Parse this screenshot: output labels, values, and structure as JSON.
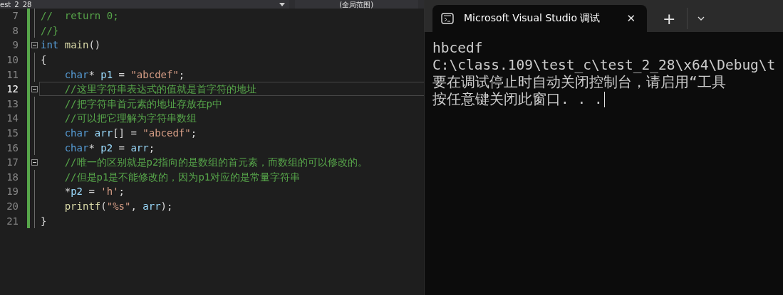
{
  "editor": {
    "file_selector": {
      "label": "est_2_28"
    },
    "scope_selector": {
      "label": "(全局范围)"
    },
    "lines": [
      {
        "number": "7",
        "current": false,
        "collapsible": false,
        "indented": false,
        "tokens": [
          {
            "kind": "comment",
            "text": "//  return 0;"
          }
        ]
      },
      {
        "number": "8",
        "current": false,
        "collapsible": false,
        "indented": false,
        "tokens": [
          {
            "kind": "comment",
            "text": "//}"
          }
        ]
      },
      {
        "number": "9",
        "current": false,
        "collapsible": true,
        "indented": false,
        "tokens": [
          {
            "kind": "keyword",
            "text": "int "
          },
          {
            "kind": "function",
            "text": "main"
          },
          {
            "kind": "plain",
            "text": "()"
          }
        ]
      },
      {
        "number": "10",
        "current": false,
        "collapsible": false,
        "indented": false,
        "tokens": [
          {
            "kind": "plain",
            "text": "{"
          }
        ]
      },
      {
        "number": "11",
        "current": false,
        "collapsible": false,
        "indented": true,
        "tokens": [
          {
            "kind": "keyword",
            "text": "char"
          },
          {
            "kind": "plain",
            "text": "* "
          },
          {
            "kind": "variable",
            "text": "p1"
          },
          {
            "kind": "plain",
            "text": " = "
          },
          {
            "kind": "string",
            "text": "\"abcdef\""
          },
          {
            "kind": "plain",
            "text": ";"
          }
        ]
      },
      {
        "number": "12",
        "current": true,
        "collapsible": true,
        "indented": true,
        "tokens": [
          {
            "kind": "comment",
            "text": "//这里字符串表达式的值就是首字符的地址"
          }
        ]
      },
      {
        "number": "13",
        "current": false,
        "collapsible": false,
        "indented": true,
        "tokens": [
          {
            "kind": "comment",
            "text": "//把字符串首元素的地址存放在p中"
          }
        ]
      },
      {
        "number": "14",
        "current": false,
        "collapsible": false,
        "indented": true,
        "tokens": [
          {
            "kind": "comment",
            "text": "//可以把它理解为字符串数组"
          }
        ]
      },
      {
        "number": "15",
        "current": false,
        "collapsible": false,
        "indented": true,
        "tokens": [
          {
            "kind": "keyword",
            "text": "char "
          },
          {
            "kind": "variable",
            "text": "arr"
          },
          {
            "kind": "plain",
            "text": "[] = "
          },
          {
            "kind": "string",
            "text": "\"abcedf\""
          },
          {
            "kind": "plain",
            "text": ";"
          }
        ]
      },
      {
        "number": "16",
        "current": false,
        "collapsible": false,
        "indented": true,
        "tokens": [
          {
            "kind": "keyword",
            "text": "char"
          },
          {
            "kind": "plain",
            "text": "* "
          },
          {
            "kind": "variable",
            "text": "p2"
          },
          {
            "kind": "plain",
            "text": " = "
          },
          {
            "kind": "variable",
            "text": "arr"
          },
          {
            "kind": "plain",
            "text": ";"
          }
        ]
      },
      {
        "number": "17",
        "current": false,
        "collapsible": true,
        "indented": true,
        "tokens": [
          {
            "kind": "comment",
            "text": "//唯一的区别就是p2指向的是数组的首元素，而数组的可以修改的。"
          }
        ]
      },
      {
        "number": "18",
        "current": false,
        "collapsible": false,
        "indented": true,
        "tokens": [
          {
            "kind": "comment",
            "text": "//但是p1是不能修改的，因为p1对应的是常量字符串"
          }
        ]
      },
      {
        "number": "19",
        "current": false,
        "collapsible": false,
        "indented": true,
        "tokens": [
          {
            "kind": "plain",
            "text": "*"
          },
          {
            "kind": "variable",
            "text": "p2"
          },
          {
            "kind": "plain",
            "text": " = "
          },
          {
            "kind": "string",
            "text": "'h'"
          },
          {
            "kind": "plain",
            "text": ";"
          }
        ]
      },
      {
        "number": "20",
        "current": false,
        "collapsible": false,
        "indented": true,
        "tokens": [
          {
            "kind": "function",
            "text": "printf"
          },
          {
            "kind": "plain",
            "text": "("
          },
          {
            "kind": "string",
            "text": "\"%s\""
          },
          {
            "kind": "plain",
            "text": ", "
          },
          {
            "kind": "variable",
            "text": "arr"
          },
          {
            "kind": "plain",
            "text": ");"
          }
        ]
      },
      {
        "number": "21",
        "current": false,
        "collapsible": false,
        "indented": false,
        "tokens": [
          {
            "kind": "plain",
            "text": "}"
          }
        ]
      }
    ]
  },
  "terminal": {
    "tab": {
      "title": "Microsoft Visual Studio 调试",
      "selected": true,
      "close": "✕"
    },
    "new_tab": "+",
    "output": [
      {
        "text": "hbcedf",
        "cursor": false
      },
      {
        "text": "C:\\class.109\\test_c\\test_2_28\\x64\\Debug\\t",
        "cursor": false
      },
      {
        "text": "要在调试停止时自动关闭控制台，请启用“工具",
        "cursor": false
      },
      {
        "text": "按任意键关闭此窗口. . .",
        "cursor": true
      }
    ]
  }
}
